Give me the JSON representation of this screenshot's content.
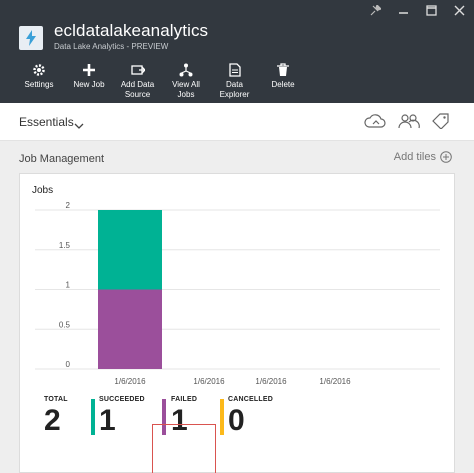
{
  "window": {
    "title": "ecldatalakeanalytics",
    "subtitle": "Data Lake Analytics - PREVIEW",
    "controls": [
      "pin-icon",
      "close-icon",
      "maximize-icon",
      "close-icon"
    ]
  },
  "toolbar": {
    "buttons": [
      {
        "label": "Settings",
        "icon": "gear-icon"
      },
      {
        "label": "New Job",
        "icon": "plus-icon"
      },
      {
        "label": "Add Data\nSource",
        "icon": "data-source-icon"
      },
      {
        "label": "View All\nJobs",
        "icon": "jobs-icon"
      },
      {
        "label": "Data\nExplorer",
        "icon": "document-icon"
      },
      {
        "label": "Delete",
        "icon": "trash-icon"
      }
    ]
  },
  "essentials": {
    "label": "Essentials",
    "icons": [
      "cloud-icon",
      "users-icon",
      "tag-icon"
    ]
  },
  "section": {
    "title": "Job Management",
    "add_tiles": "Add tiles"
  },
  "tile": {
    "title": "Jobs"
  },
  "chart_data": {
    "type": "bar",
    "stacked": true,
    "categories": [
      "1/6/2016",
      "1/6/2016",
      "1/6/2016",
      "1/6/2016"
    ],
    "series": [
      {
        "name": "FAILED",
        "values": [
          1,
          0,
          0,
          0
        ],
        "color": "#9b4f9b"
      },
      {
        "name": "SUCCEEDED",
        "values": [
          1,
          0,
          0,
          0
        ],
        "color": "#00b294"
      }
    ],
    "yticks": [
      "0",
      "0.5",
      "1",
      "1.5",
      "2"
    ],
    "ylim": [
      0,
      2
    ],
    "grid": true
  },
  "stats": [
    {
      "label": "TOTAL",
      "value": "2",
      "color": ""
    },
    {
      "label": "SUCCEEDED",
      "value": "1",
      "color": "#00b294"
    },
    {
      "label": "FAILED",
      "value": "1",
      "color": "#9b4f9b"
    },
    {
      "label": "CANCELLED",
      "value": "0",
      "color": "#fcb91a"
    }
  ]
}
